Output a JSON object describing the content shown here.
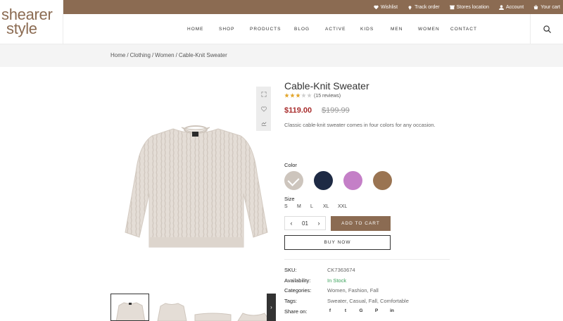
{
  "brand": {
    "line1": "shearer",
    "line2": "style",
    "color": "#8b6b52"
  },
  "topbar": {
    "links": [
      {
        "label": "Wishlist",
        "icon": "heart-icon"
      },
      {
        "label": "Track order",
        "icon": "location-pin-icon"
      },
      {
        "label": "Stores location",
        "icon": "store-icon"
      },
      {
        "label": "Account",
        "icon": "user-icon"
      },
      {
        "label": "Your cart",
        "icon": "cart-icon"
      }
    ]
  },
  "nav": {
    "items": [
      "HOME",
      "SHOP",
      "PRODUCTS",
      "BLOG",
      "ACTIVE",
      "KIDS",
      "MEN",
      "WOMEN",
      "CONTACT"
    ],
    "search_icon": "search-icon"
  },
  "breadcrumb": [
    "Home",
    "Clothing",
    "Women",
    "Cable-Knit Sweater"
  ],
  "breadcrumb_sep": "/",
  "product": {
    "title": "Cable-Knit Sweater",
    "rating": 3,
    "rating_max": 5,
    "reviews": "(15 reviews)",
    "price": "$119.00",
    "old_price": "$199.99",
    "description": "Classic cable-knit sweater comes in four colors for any occasion.",
    "color_label": "Color",
    "colors": [
      {
        "name": "cream",
        "hex": "#cdc5bd",
        "selected": true
      },
      {
        "name": "navy",
        "hex": "#1e2a44",
        "selected": false
      },
      {
        "name": "lilac",
        "hex": "#c47fc7",
        "selected": false
      },
      {
        "name": "camel",
        "hex": "#9a7452",
        "selected": false
      }
    ],
    "size_label": "Size",
    "sizes": [
      "S",
      "M",
      "L",
      "XL",
      "XXL"
    ],
    "quantity": "01",
    "add_to_cart": "ADD TO CART",
    "buy_now": "BUY NOW",
    "meta": {
      "sku_label": "SKU:",
      "sku": "CK7363674",
      "availability_label": "Availability:",
      "availability": "In Stock",
      "categories_label": "Categories:",
      "categories": "Women, Fashion, Fall",
      "tags_label": "Tags:",
      "tags": "Sweater, Casual, Fall, Comfortable",
      "share_label": "Share on:"
    },
    "share_icons": [
      "facebook-icon",
      "twitter-icon",
      "google-icon",
      "pinterest-icon",
      "linkedin-icon"
    ],
    "share_glyphs": [
      "f",
      "t",
      "G",
      "P",
      "in"
    ]
  },
  "colors": {
    "accent": "#8b6b52",
    "price": "#a82d2d",
    "in_stock": "#3aa15a"
  }
}
